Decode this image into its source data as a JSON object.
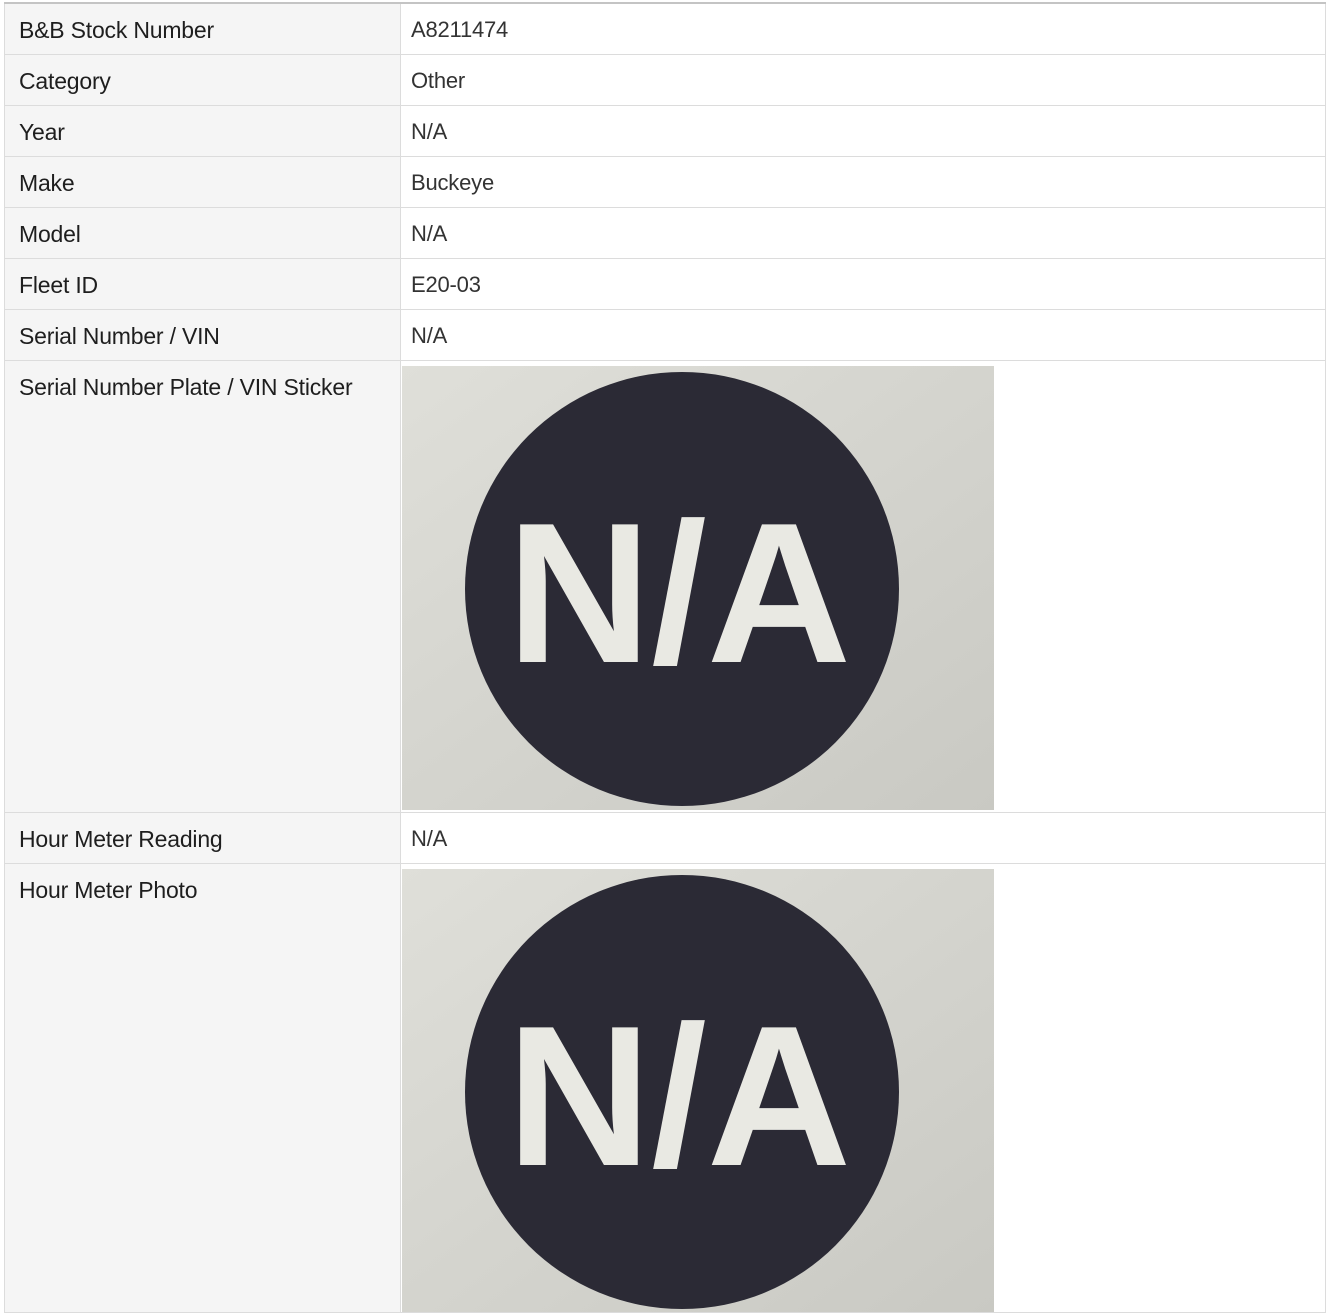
{
  "specs": {
    "stock_number": {
      "label": "B&B Stock Number",
      "value": "A8211474"
    },
    "category": {
      "label": "Category",
      "value": "Other"
    },
    "year": {
      "label": "Year",
      "value": "N/A"
    },
    "make": {
      "label": "Make",
      "value": "Buckeye"
    },
    "model": {
      "label": "Model",
      "value": "N/A"
    },
    "fleet_id": {
      "label": "Fleet ID",
      "value": "E20-03"
    },
    "serial_number": {
      "label": "Serial Number / VIN",
      "value": "N/A"
    },
    "serial_plate": {
      "label": "Serial Number Plate / VIN Sticker",
      "image_text": "N/A"
    },
    "hour_meter_reading": {
      "label": "Hour Meter Reading",
      "value": "N/A"
    },
    "hour_meter_photo": {
      "label": "Hour Meter Photo",
      "image_text": "N/A"
    }
  },
  "colors": {
    "label_background": "#f5f5f5",
    "border": "#dcdcdc",
    "photo_background": "#dcdcd6",
    "badge": "#2b2a35",
    "badge_text": "#e9e9e3"
  }
}
